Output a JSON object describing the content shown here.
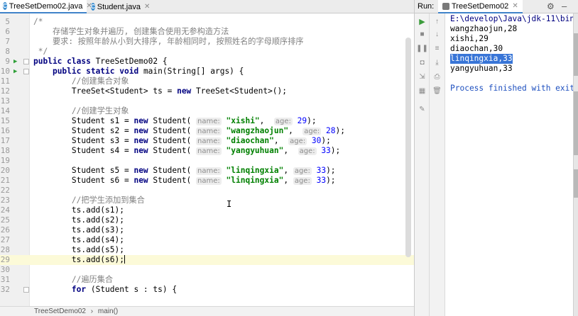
{
  "editor_tabs": [
    {
      "label": "TreeSetDemo02.java",
      "icon": "C",
      "active": true
    },
    {
      "label": "Student.java",
      "icon": "C",
      "active": false
    }
  ],
  "code_lines": [
    {
      "n": "5",
      "segs": [
        {
          "c": "cmt",
          "t": "/*"
        }
      ]
    },
    {
      "n": "6",
      "segs": [
        {
          "c": "cmt",
          "t": "    存储学生对象并遍历, 创建集合使用无参构造方法"
        }
      ]
    },
    {
      "n": "7",
      "segs": [
        {
          "c": "cmt",
          "t": "    要求: 按照年龄从小到大排序, 年龄相同时, 按照姓名的字母顺序排序"
        }
      ]
    },
    {
      "n": "8",
      "segs": [
        {
          "c": "cmt",
          "t": " */"
        }
      ]
    },
    {
      "n": "9",
      "marker": "run",
      "fold": true,
      "segs": [
        {
          "c": "kw",
          "t": "public class "
        },
        {
          "c": "",
          "t": "TreeSetDemo02 {"
        }
      ]
    },
    {
      "n": "10",
      "marker": "run",
      "fold": true,
      "segs": [
        {
          "c": "",
          "t": "    "
        },
        {
          "c": "kw",
          "t": "public static void "
        },
        {
          "c": "",
          "t": "main(String[] args) {"
        }
      ]
    },
    {
      "n": "11",
      "segs": [
        {
          "c": "cmt",
          "t": "        //创建集合对象"
        }
      ]
    },
    {
      "n": "12",
      "segs": [
        {
          "c": "",
          "t": "        TreeSet<Student> ts = "
        },
        {
          "c": "kw",
          "t": "new "
        },
        {
          "c": "",
          "t": "TreeSet<Student>();"
        }
      ]
    },
    {
      "n": "13",
      "segs": []
    },
    {
      "n": "14",
      "segs": [
        {
          "c": "cmt",
          "t": "        //创建学生对象"
        }
      ]
    },
    {
      "n": "15",
      "segs": [
        {
          "c": "",
          "t": "        Student s1 = "
        },
        {
          "c": "kw",
          "t": "new "
        },
        {
          "c": "",
          "t": "Student( "
        },
        {
          "c": "hint",
          "t": "name:"
        },
        {
          "c": "",
          "t": " "
        },
        {
          "c": "str",
          "t": "\"xishi\""
        },
        {
          "c": "",
          "t": ",  "
        },
        {
          "c": "hint",
          "t": "age:"
        },
        {
          "c": "",
          "t": " "
        },
        {
          "c": "num",
          "t": "29"
        },
        {
          "c": "",
          "t": ");"
        }
      ]
    },
    {
      "n": "16",
      "segs": [
        {
          "c": "",
          "t": "        Student s2 = "
        },
        {
          "c": "kw",
          "t": "new "
        },
        {
          "c": "",
          "t": "Student( "
        },
        {
          "c": "hint",
          "t": "name:"
        },
        {
          "c": "",
          "t": " "
        },
        {
          "c": "str",
          "t": "\"wangzhaojun\""
        },
        {
          "c": "",
          "t": ",  "
        },
        {
          "c": "hint",
          "t": "age:"
        },
        {
          "c": "",
          "t": " "
        },
        {
          "c": "num",
          "t": "28"
        },
        {
          "c": "",
          "t": ");"
        }
      ]
    },
    {
      "n": "17",
      "segs": [
        {
          "c": "",
          "t": "        Student s3 = "
        },
        {
          "c": "kw",
          "t": "new "
        },
        {
          "c": "",
          "t": "Student( "
        },
        {
          "c": "hint",
          "t": "name:"
        },
        {
          "c": "",
          "t": " "
        },
        {
          "c": "str",
          "t": "\"diaochan\""
        },
        {
          "c": "",
          "t": ",  "
        },
        {
          "c": "hint",
          "t": "age:"
        },
        {
          "c": "",
          "t": " "
        },
        {
          "c": "num",
          "t": "30"
        },
        {
          "c": "",
          "t": ");"
        }
      ]
    },
    {
      "n": "18",
      "segs": [
        {
          "c": "",
          "t": "        Student s4 = "
        },
        {
          "c": "kw",
          "t": "new "
        },
        {
          "c": "",
          "t": "Student( "
        },
        {
          "c": "hint",
          "t": "name:"
        },
        {
          "c": "",
          "t": " "
        },
        {
          "c": "str",
          "t": "\"yangyuhuan\""
        },
        {
          "c": "",
          "t": ",  "
        },
        {
          "c": "hint",
          "t": "age:"
        },
        {
          "c": "",
          "t": " "
        },
        {
          "c": "num",
          "t": "33"
        },
        {
          "c": "",
          "t": ");"
        }
      ]
    },
    {
      "n": "19",
      "segs": []
    },
    {
      "n": "20",
      "segs": [
        {
          "c": "",
          "t": "        Student s5 = "
        },
        {
          "c": "kw",
          "t": "new "
        },
        {
          "c": "",
          "t": "Student( "
        },
        {
          "c": "hint",
          "t": "name:"
        },
        {
          "c": "",
          "t": " "
        },
        {
          "c": "str",
          "t": "\"linqingxia\""
        },
        {
          "c": "",
          "t": ", "
        },
        {
          "c": "hint",
          "t": "age:"
        },
        {
          "c": "",
          "t": " "
        },
        {
          "c": "num",
          "t": "33"
        },
        {
          "c": "",
          "t": ");"
        }
      ]
    },
    {
      "n": "21",
      "segs": [
        {
          "c": "",
          "t": "        Student s6 = "
        },
        {
          "c": "kw",
          "t": "new "
        },
        {
          "c": "",
          "t": "Student( "
        },
        {
          "c": "hint",
          "t": "name:"
        },
        {
          "c": "",
          "t": " "
        },
        {
          "c": "str",
          "t": "\"linqingxia\""
        },
        {
          "c": "",
          "t": ", "
        },
        {
          "c": "hint",
          "t": "age:"
        },
        {
          "c": "",
          "t": " "
        },
        {
          "c": "num",
          "t": "33"
        },
        {
          "c": "",
          "t": ");"
        }
      ]
    },
    {
      "n": "22",
      "segs": []
    },
    {
      "n": "23",
      "segs": [
        {
          "c": "cmt",
          "t": "        //把学生添加到集合"
        }
      ]
    },
    {
      "n": "24",
      "segs": [
        {
          "c": "",
          "t": "        ts.add(s1);"
        }
      ]
    },
    {
      "n": "25",
      "segs": [
        {
          "c": "",
          "t": "        ts.add(s2);"
        }
      ]
    },
    {
      "n": "26",
      "segs": [
        {
          "c": "",
          "t": "        ts.add(s3);"
        }
      ]
    },
    {
      "n": "27",
      "segs": [
        {
          "c": "",
          "t": "        ts.add(s4);"
        }
      ]
    },
    {
      "n": "28",
      "segs": [
        {
          "c": "",
          "t": "        ts.add(s5);"
        }
      ]
    },
    {
      "n": "29",
      "current": true,
      "caret": true,
      "segs": [
        {
          "c": "",
          "t": "        ts.add(s6);"
        }
      ]
    },
    {
      "n": "30",
      "segs": []
    },
    {
      "n": "31",
      "segs": [
        {
          "c": "cmt",
          "t": "        //遍历集合"
        }
      ]
    },
    {
      "n": "32",
      "fold": true,
      "segs": [
        {
          "c": "",
          "t": "        "
        },
        {
          "c": "kw",
          "t": "for "
        },
        {
          "c": "",
          "t": "(Student s : ts) {"
        }
      ]
    }
  ],
  "breadcrumb": [
    "TreeSetDemo02",
    "›",
    "main()"
  ],
  "run_panel": {
    "label": "Run:",
    "tab_label": "TreeSetDemo02",
    "console": [
      {
        "t": "E:\\develop\\Java\\jdk-11\\bin",
        "style": "path"
      },
      {
        "t": "wangzhaojun,28",
        "style": ""
      },
      {
        "t": "xishi,29",
        "style": ""
      },
      {
        "t": "diaochan,30",
        "style": ""
      },
      {
        "t": "linqingxia,33",
        "style": "sel"
      },
      {
        "t": "yangyuhuan,33",
        "style": ""
      },
      {
        "t": "",
        "style": ""
      },
      {
        "t": "Process finished with exit",
        "style": "finish"
      }
    ]
  },
  "icons": {
    "gear": "gear-icon",
    "minimize": "minimize-icon",
    "rerun": "rerun-icon"
  }
}
